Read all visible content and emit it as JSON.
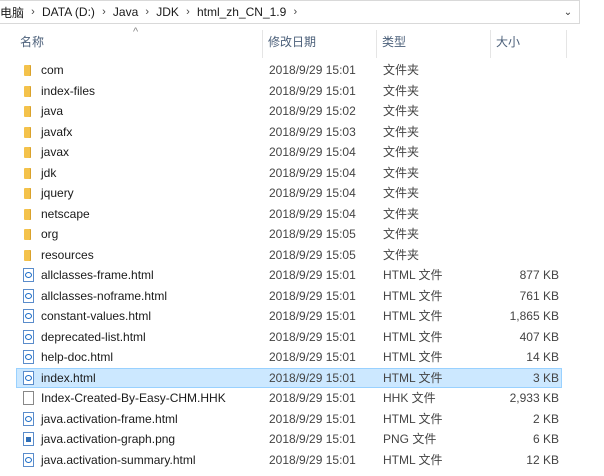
{
  "breadcrumb": {
    "items": [
      "电脑",
      "DATA (D:)",
      "Java",
      "JDK",
      "html_zh_CN_1.9"
    ]
  },
  "columns": {
    "name": "名称",
    "date": "修改日期",
    "type": "类型",
    "size": "大小"
  },
  "files": [
    {
      "name": "com",
      "date": "2018/9/29 15:01",
      "type": "文件夹",
      "size": "",
      "kind": "folder"
    },
    {
      "name": "index-files",
      "date": "2018/9/29 15:01",
      "type": "文件夹",
      "size": "",
      "kind": "folder"
    },
    {
      "name": "java",
      "date": "2018/9/29 15:02",
      "type": "文件夹",
      "size": "",
      "kind": "folder"
    },
    {
      "name": "javafx",
      "date": "2018/9/29 15:03",
      "type": "文件夹",
      "size": "",
      "kind": "folder"
    },
    {
      "name": "javax",
      "date": "2018/9/29 15:04",
      "type": "文件夹",
      "size": "",
      "kind": "folder"
    },
    {
      "name": "jdk",
      "date": "2018/9/29 15:04",
      "type": "文件夹",
      "size": "",
      "kind": "folder"
    },
    {
      "name": "jquery",
      "date": "2018/9/29 15:04",
      "type": "文件夹",
      "size": "",
      "kind": "folder"
    },
    {
      "name": "netscape",
      "date": "2018/9/29 15:04",
      "type": "文件夹",
      "size": "",
      "kind": "folder"
    },
    {
      "name": "org",
      "date": "2018/9/29 15:05",
      "type": "文件夹",
      "size": "",
      "kind": "folder"
    },
    {
      "name": "resources",
      "date": "2018/9/29 15:05",
      "type": "文件夹",
      "size": "",
      "kind": "folder"
    },
    {
      "name": "allclasses-frame.html",
      "date": "2018/9/29 15:01",
      "type": "HTML 文件",
      "size": "877 KB",
      "kind": "html"
    },
    {
      "name": "allclasses-noframe.html",
      "date": "2018/9/29 15:01",
      "type": "HTML 文件",
      "size": "761 KB",
      "kind": "html"
    },
    {
      "name": "constant-values.html",
      "date": "2018/9/29 15:01",
      "type": "HTML 文件",
      "size": "1,865 KB",
      "kind": "html"
    },
    {
      "name": "deprecated-list.html",
      "date": "2018/9/29 15:01",
      "type": "HTML 文件",
      "size": "407 KB",
      "kind": "html"
    },
    {
      "name": "help-doc.html",
      "date": "2018/9/29 15:01",
      "type": "HTML 文件",
      "size": "14 KB",
      "kind": "html"
    },
    {
      "name": "index.html",
      "date": "2018/9/29 15:01",
      "type": "HTML 文件",
      "size": "3 KB",
      "kind": "html",
      "selected": true
    },
    {
      "name": "Index-Created-By-Easy-CHM.HHK",
      "date": "2018/9/29 15:01",
      "type": "HHK 文件",
      "size": "2,933 KB",
      "kind": "txt"
    },
    {
      "name": "java.activation-frame.html",
      "date": "2018/9/29 15:01",
      "type": "HTML 文件",
      "size": "2 KB",
      "kind": "html"
    },
    {
      "name": "java.activation-graph.png",
      "date": "2018/9/29 15:01",
      "type": "PNG 文件",
      "size": "6 KB",
      "kind": "png"
    },
    {
      "name": "java.activation-summary.html",
      "date": "2018/9/29 15:01",
      "type": "HTML 文件",
      "size": "12 KB",
      "kind": "html"
    }
  ]
}
